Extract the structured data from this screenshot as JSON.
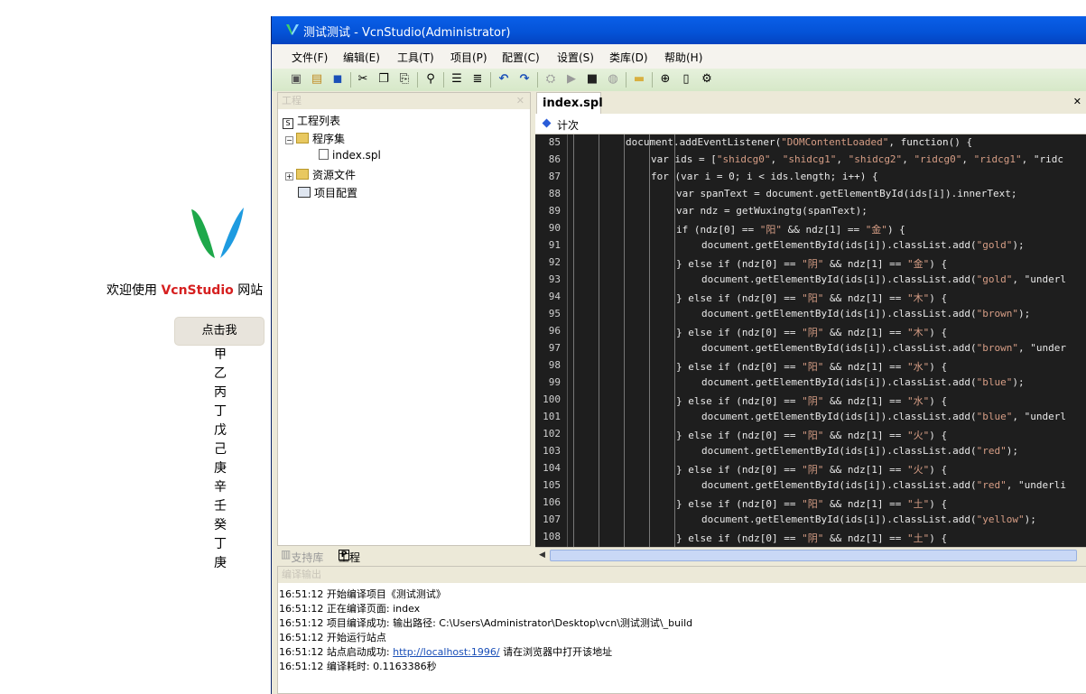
{
  "web": {
    "welcome_prefix": "欢迎使用",
    "welcome_brand": "VcnStudio",
    "welcome_suffix": "网站",
    "button_label": "点击我",
    "stems": [
      "甲",
      "乙",
      "丙",
      "丁",
      "戊",
      "己",
      "庚",
      "辛",
      "壬",
      "癸",
      "丁",
      "庚"
    ],
    "colors": {
      "brand": "#d62020",
      "logo_green": "#1ea84a",
      "logo_blue": "#1e9be0"
    }
  },
  "window": {
    "title": "测试测试 - VcnStudio(Administrator)",
    "icon": "vcnstudio-logo-icon"
  },
  "menu": [
    "文件(F)",
    "编辑(E)",
    "工具(T)",
    "项目(P)",
    "配置(C)",
    "设置(S)",
    "类库(D)",
    "帮助(H)"
  ],
  "toolbar_icons": [
    "new-project-icon",
    "open-icon",
    "save-icon",
    "cut-icon",
    "copy-icon",
    "paste-icon",
    "find-icon",
    "indent-icon",
    "outdent-icon",
    "undo-icon",
    "redo-icon",
    "build-icon",
    "run-icon",
    "stop-icon",
    "browser-icon",
    "folder-icon",
    "globe-icon",
    "document-icon",
    "settings-icon"
  ],
  "project": {
    "header": "工程",
    "pin": "✕",
    "tree": [
      "工程列表",
      "程序集",
      "index.spl",
      "资源文件",
      "项目配置"
    ],
    "tabs": [
      "支持库",
      "工程"
    ]
  },
  "editor": {
    "tab": "index.spl",
    "close": "✕",
    "nav_label": "计次",
    "lines": [
      {
        "n": "85",
        "t": "document.addEventListener(\"DOMContentLoaded\", function() {"
      },
      {
        "n": "86",
        "t": "var ids = [\"shidcg0\", \"shidcg1\", \"shidcg2\", \"ridcg0\", \"ridcg1\", \"ridc"
      },
      {
        "n": "87",
        "t": "for (var i = 0; i < ids.length; i++) {"
      },
      {
        "n": "88",
        "t": "var spanText = document.getElementById(ids[i]).innerText;"
      },
      {
        "n": "89",
        "t": "var ndz = getWuxingtg(spanText);"
      },
      {
        "n": "90",
        "t": "if (ndz[0] == \"阳\" && ndz[1] == \"金\") {"
      },
      {
        "n": "91",
        "t": "document.getElementById(ids[i]).classList.add(\"gold\");"
      },
      {
        "n": "92",
        "t": "} else if (ndz[0] == \"阴\" && ndz[1] == \"金\") {"
      },
      {
        "n": "93",
        "t": "document.getElementById(ids[i]).classList.add(\"gold\", \"underl"
      },
      {
        "n": "94",
        "t": "} else if (ndz[0] == \"阳\" && ndz[1] == \"木\") {"
      },
      {
        "n": "95",
        "t": "document.getElementById(ids[i]).classList.add(\"brown\");"
      },
      {
        "n": "96",
        "t": "} else if (ndz[0] == \"阴\" && ndz[1] == \"木\") {"
      },
      {
        "n": "97",
        "t": "document.getElementById(ids[i]).classList.add(\"brown\", \"under"
      },
      {
        "n": "98",
        "t": "} else if (ndz[0] == \"阳\" && ndz[1] == \"水\") {"
      },
      {
        "n": "99",
        "t": "document.getElementById(ids[i]).classList.add(\"blue\");"
      },
      {
        "n": "100",
        "t": "} else if (ndz[0] == \"阴\" && ndz[1] == \"水\") {"
      },
      {
        "n": "101",
        "t": "document.getElementById(ids[i]).classList.add(\"blue\", \"underl"
      },
      {
        "n": "102",
        "t": "} else if (ndz[0] == \"阳\" && ndz[1] == \"火\") {"
      },
      {
        "n": "103",
        "t": "document.getElementById(ids[i]).classList.add(\"red\");"
      },
      {
        "n": "104",
        "t": "} else if (ndz[0] == \"阴\" && ndz[1] == \"火\") {"
      },
      {
        "n": "105",
        "t": "document.getElementById(ids[i]).classList.add(\"red\", \"underli"
      },
      {
        "n": "106",
        "t": "} else if (ndz[0] == \"阳\" && ndz[1] == \"土\") {"
      },
      {
        "n": "107",
        "t": "document.getElementById(ids[i]).classList.add(\"yellow\");"
      },
      {
        "n": "108",
        "t": "} else if (ndz[0] == \"阴\" && ndz[1] == \"土\") {"
      }
    ],
    "colors": {
      "background": "#1e1e1e",
      "string": "#d69d85",
      "text": "#e8e8e8"
    }
  },
  "output": {
    "header": "编译输出",
    "lines": [
      {
        "text": "16:51:12 开始编译项目《测试测试》"
      },
      {
        "text": "16:51:12 正在编译页面: index"
      },
      {
        "text": "16:51:12 项目编译成功: 输出路径: C:\\Users\\Administrator\\Desktop\\vcn\\测试测试\\_build"
      },
      {
        "text": "16:51:12 开始运行站点"
      },
      {
        "text": "16:51:12 站点启动成功: ",
        "link": "http://localhost:1996/",
        "after": " 请在浏览器中打开该地址"
      },
      {
        "text": "16:51:12 编译耗时: 0.1163386秒"
      }
    ]
  }
}
